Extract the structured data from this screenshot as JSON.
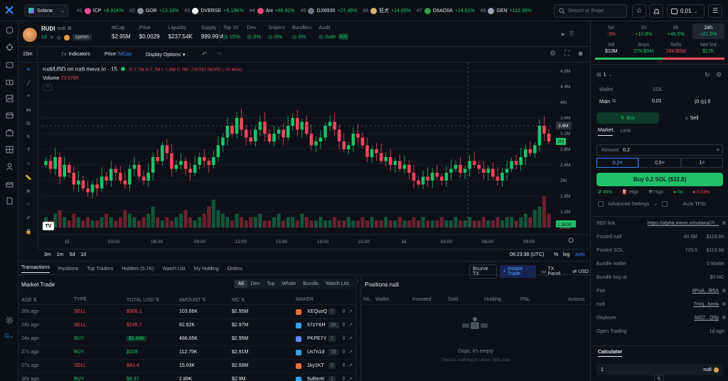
{
  "topbar": {
    "network": "Solana",
    "trending": [
      {
        "rank": "#1",
        "name": "ICP",
        "change": "+8.91K%",
        "icon_color": "#e64a9b"
      },
      {
        "rank": "#2",
        "name": "GOR",
        "change": "+13.33%",
        "icon_color": "#8a8f98"
      },
      {
        "rank": "#3",
        "name": "DVERSE",
        "change": "+5.13K%",
        "icon_color": "#ffffff"
      },
      {
        "rank": "#4",
        "name": "Ani",
        "change": "+89.92%",
        "icon_color": "#e34b7b"
      },
      {
        "rank": "#5",
        "name": "DJI6930",
        "change": "+27.46%",
        "icon_color": "#6b7280"
      },
      {
        "rank": "#6",
        "name": "狂犬",
        "change": "+14.65%",
        "icon_color": "#d9b36b"
      },
      {
        "rank": "#7",
        "name": "OIIAOIIA",
        "change": "+14.61%",
        "icon_color": "#2ea043"
      },
      {
        "rank": "#8",
        "name": "GEN",
        "change": "+112.96%",
        "icon_color": "#9aa4b2"
      }
    ],
    "search_placeholder": "Search or Snipe",
    "wallet_balance": "0.01"
  },
  "token": {
    "symbol": "RUDI",
    "name": "rudi",
    "age": "1d",
    "tag": "cpmm",
    "stats": [
      {
        "label": "MCap",
        "value": "$2.95M"
      },
      {
        "label": "Price",
        "value": "$0.0029"
      },
      {
        "label": "Liquidity",
        "value": "$237.54K"
      },
      {
        "label": "Supply",
        "value": "999.99M"
      }
    ],
    "audit": [
      {
        "label": "Top 10",
        "value": "15%"
      },
      {
        "label": "Dev",
        "value": "0%"
      },
      {
        "label": "Snipers",
        "value": "0%"
      },
      {
        "label": "Bundlers",
        "value": "0%"
      },
      {
        "label": "Audit",
        "value": "Safe",
        "extra": "6/6"
      }
    ]
  },
  "chart_toolbar": {
    "interval": "15m",
    "indicators": "Indicators",
    "price_label": "Price",
    "mcap_label": "MCap",
    "display_options": "Display Options"
  },
  "chart_legend": {
    "title": "rudi/USD on rudi mevx.io · 15",
    "ohlc": "O 2.2M H 2.2M L 1.8M C 2M",
    "change": "-230742.56200 (-10.46%)",
    "volume_label": "Volume",
    "volume_value": "73.576K"
  },
  "chart_bottom": {
    "ranges": [
      "3m",
      "1m",
      "5d",
      "1d"
    ],
    "time": "08:23:38 (UTC)",
    "pct": "%",
    "log": "log",
    "auto": "auto"
  },
  "chart_data": {
    "type": "candlestick",
    "y_ticks": [
      "4.8M",
      "4.4M",
      "4M",
      "3.6M",
      "3.2M",
      "2.8M",
      "2.4M",
      "2M",
      "1.6M",
      "1.2M",
      "800K"
    ],
    "x_ticks": [
      "15",
      "03:00",
      "06:00",
      "09:00",
      "12:00",
      "15:00",
      "18:00",
      "21:00",
      "16",
      "03:00",
      "06:00",
      "09:00"
    ],
    "ylim": [
      800000,
      4800000
    ],
    "last_price_label": "3.4M",
    "current_price_label": "3M",
    "volume_badge": "1.989K",
    "candles": [
      2.5,
      2.3,
      2.6,
      2.1,
      2.4,
      2.2,
      1.9,
      2.0,
      1.8,
      1.7,
      1.9,
      1.8,
      2.1,
      2.0,
      2.3,
      2.2,
      2.0,
      1.9,
      2.3,
      2.4,
      2.1,
      2.0,
      2.2,
      2.6,
      2.5,
      2.9,
      2.7,
      2.3,
      2.4,
      2.5,
      2.3,
      2.2,
      2.4,
      2.6,
      2.5,
      2.4,
      2.6,
      2.9,
      3.1,
      3.4,
      3.2,
      3.6,
      3.3,
      3.1,
      3.0,
      3.3,
      3.5,
      3.2,
      3.0,
      3.2,
      3.3,
      3.1,
      3.4,
      3.6,
      3.3,
      3.5,
      3.2,
      2.9,
      3.0,
      3.1,
      3.4,
      3.5,
      3.3,
      3.0,
      2.8,
      2.9,
      3.2,
      3.1,
      2.9,
      2.6,
      2.8,
      2.7,
      2.5,
      2.6,
      2.4,
      2.5,
      2.3,
      2.4,
      2.2,
      2.0,
      1.9,
      2.1,
      2.0,
      2.2,
      2.1,
      2.0,
      2.2,
      2.3,
      2.4,
      2.2,
      2.3,
      2.5,
      2.4,
      2.3,
      2.2,
      2.3,
      2.1,
      2.0,
      2.2,
      2.3,
      2.5,
      2.4,
      2.6,
      2.8,
      2.7,
      2.9,
      3.4,
      3.2,
      3.0
    ],
    "volumes": [
      3,
      2,
      4,
      5,
      3,
      2,
      4,
      3,
      2,
      3,
      2,
      2,
      3,
      4,
      3,
      2,
      3,
      5,
      4,
      3,
      2,
      3,
      4,
      6,
      3,
      2,
      3,
      2,
      3,
      4,
      5,
      3,
      2,
      3,
      4,
      6,
      8,
      5,
      4,
      3,
      2,
      4,
      3,
      2,
      3,
      3,
      4,
      2,
      2,
      3,
      4,
      2,
      3,
      3,
      2,
      4,
      3,
      2,
      2,
      3,
      2,
      2,
      3,
      2,
      2,
      3,
      2,
      2,
      3,
      2,
      3,
      2,
      2,
      3,
      2,
      2,
      3,
      2,
      2,
      3,
      2,
      3,
      2,
      2,
      2,
      3,
      2,
      2,
      3,
      2,
      2,
      3,
      2,
      2,
      3,
      2,
      2,
      3,
      2,
      3,
      3,
      2,
      3,
      4,
      3,
      5,
      6,
      9,
      4
    ]
  },
  "market_stats": {
    "timeframes": [
      {
        "label": "5m",
        "value": "-3%",
        "tone": "red"
      },
      {
        "label": "1h",
        "value": "+10.8%",
        "tone": "green"
      },
      {
        "label": "6h",
        "value": "+46.5%",
        "tone": "green"
      },
      {
        "label": "24h",
        "value": "+21.6%",
        "tone": "green"
      }
    ],
    "flows": [
      {
        "label": "Vol",
        "value": "$10M",
        "tone": "white"
      },
      {
        "label": "Buys",
        "value": "27K/$5M",
        "tone": "green"
      },
      {
        "label": "Sells",
        "value": "26K/$5M",
        "tone": "red"
      },
      {
        "label": "Net Vol",
        "value": "$17K",
        "tone": "green"
      }
    ]
  },
  "trade_panel": {
    "wallet_count": "1",
    "wallet_header": "Wallet",
    "sol_header": "SOL",
    "wallet_name": "Main",
    "wallet_sol": "0.01",
    "wallet_token": "(0 ◎) 0",
    "buy_tab": "Buy",
    "sell_tab": "Sell",
    "order_types": [
      "Market",
      "Limit"
    ],
    "amount_label": "Amount",
    "amount_value": "0.2",
    "presets": [
      "0.2",
      "0.5",
      "1"
    ],
    "buy_button": "Buy 0.2 SOL ($32.8)",
    "slippage": "49%",
    "priority": "High",
    "bribe": "High",
    "tip": "0n",
    "fee": "0.03%",
    "advanced": "Advanced Settings",
    "auto_tpsl": "Auto TPSL"
  },
  "info": {
    "rows": [
      {
        "label": "REF link",
        "value": "https://alpha.mevx.io/solana/7r..."
      },
      {
        "label": "Pooled rudi",
        "value": "40.5M",
        "value2": "$119.6K"
      },
      {
        "label": "Pooled SOL",
        "value": "729.5",
        "value2": "$119.6K"
      },
      {
        "label": "Bundle wallet",
        "value": "0 Wallet"
      },
      {
        "label": "Bundle buy at",
        "value": "$0 MC"
      },
      {
        "label": "Pair",
        "value": "8PoA...f85A"
      },
      {
        "label": "rudi",
        "value": "7rVq...bonk"
      },
      {
        "label": "Deployer",
        "value": "6d22...Qflp"
      },
      {
        "label": "Open Trading",
        "value": "1d ago"
      }
    ],
    "calculator_title": "Calculator",
    "calc_amount": "1",
    "calc_unit": "rudi"
  },
  "bottom_tabs": {
    "tabs": [
      "Transactions",
      "Positions",
      "Top Traders",
      "Holders (5.7K)",
      "Watch List",
      "My Holding",
      "Orders"
    ],
    "badges": [
      "Bcurve TX",
      "Instant Trade",
      "TX Panel",
      "USD"
    ]
  },
  "market_trade": {
    "title": "Market Trade",
    "filters": [
      "All",
      "Dev",
      "Top",
      "Whale",
      "Bundle",
      "Watch List"
    ],
    "headers": [
      "AGE",
      "TYPE",
      "TOTAL USD",
      "AMOUNT",
      "MC",
      "MAKER"
    ],
    "rows": [
      {
        "age": "20s ago",
        "type": "SELL",
        "total": "$306.1",
        "amount": "103.66K",
        "mc": "$2.95M",
        "maker": "XEQuoQ",
        "count": "7"
      },
      {
        "age": "24s ago",
        "type": "SELL",
        "total": "$245.7",
        "amount": "82.82K",
        "mc": "$2.97M",
        "maker": "57zYKH",
        "count": "2K"
      },
      {
        "age": "24s ago",
        "type": "BUY",
        "total": "$1.44K",
        "amount": "486.65K",
        "mc": "$2.95M",
        "maker": "PKPE7Y",
        "count": "7"
      },
      {
        "age": "27s ago",
        "type": "BUY",
        "total": "$328",
        "amount": "112.75K",
        "mc": "$2.91M",
        "maker": "Us7n1d",
        "count": "16"
      },
      {
        "age": "27s ago",
        "type": "SELL",
        "total": "$43.4",
        "amount": "15.03K",
        "mc": "$2.89M",
        "maker": "1ky1KT",
        "count": "2"
      },
      {
        "age": "30s ago",
        "type": "BUY",
        "total": "$8.37",
        "amount": "2.89K",
        "mc": "$2.9M",
        "maker": "5uBezK",
        "count": "1"
      }
    ]
  },
  "positions": {
    "title": "Positions rudi",
    "headers": [
      "No.",
      "Wallet",
      "Invested",
      "Sold",
      "Holding",
      "PNL",
      "Actions"
    ],
    "empty_title": "Oops, it's empty",
    "empty_sub": "There's nothing to show right now"
  },
  "colors": {
    "green": "#1fc16b",
    "red": "#f6465d",
    "accent": "#2962ff",
    "bg": "#0d1117"
  }
}
